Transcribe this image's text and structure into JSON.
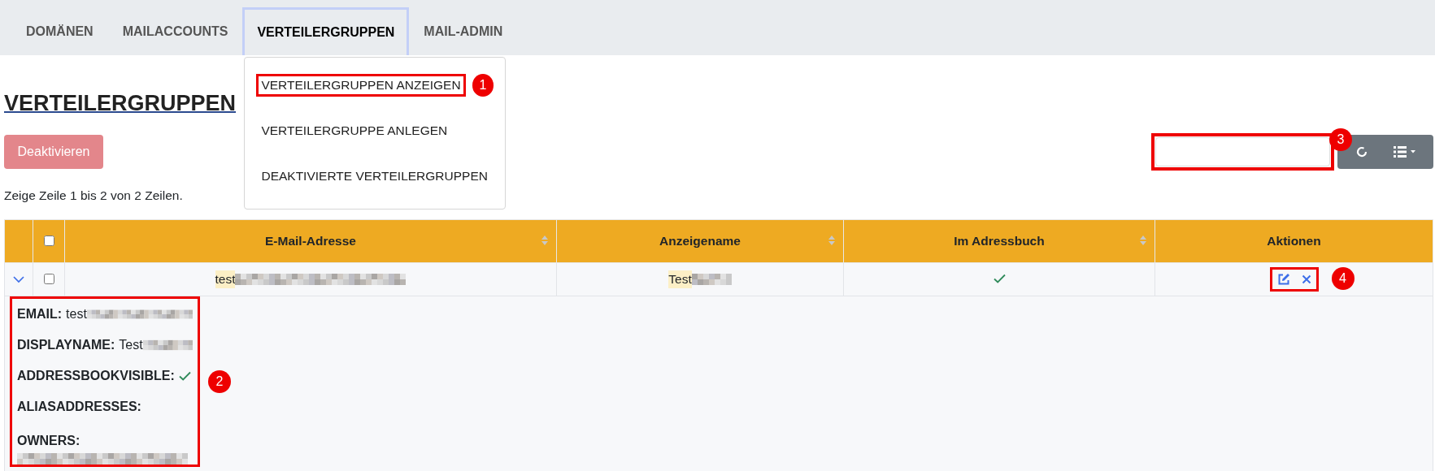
{
  "nav": {
    "tabs": [
      {
        "label": "DOMÄNEN",
        "selected": false
      },
      {
        "label": "MAILACCOUNTS",
        "selected": false
      },
      {
        "label": "VERTEILERGRUPPEN",
        "selected": true
      },
      {
        "label": "MAIL-ADMIN",
        "selected": false
      }
    ]
  },
  "dropdown": {
    "items": [
      {
        "label": "VERTEILERGRUPPEN ANZEIGEN",
        "annotation": "1"
      },
      {
        "label": "VERTEILERGRUPPE ANLEGEN"
      },
      {
        "label": "DEAKTIVIERTE VERTEILERGRUPPEN"
      }
    ]
  },
  "page_title": "VERTEILERGRUPPEN",
  "deactivate_button": {
    "label": "Deaktivieren",
    "disabled": true
  },
  "row_info": "Zeige Zeile 1 bis 2 von 2 Zeilen.",
  "search": {
    "annotation": "3"
  },
  "table": {
    "select_all_checked": false,
    "columns": [
      {
        "label": "E-Mail-Adresse",
        "sortable": true
      },
      {
        "label": "Anzeigename",
        "sortable": true
      },
      {
        "label": "Im Adressbuch",
        "sortable": true
      },
      {
        "label": "Aktionen",
        "sortable": false
      }
    ],
    "rows": [
      {
        "expanded": true,
        "checked": false,
        "email": "test",
        "email_redacted": true,
        "name": "Test",
        "name_redacted": true,
        "in_addressbook": true,
        "actions_annotation": "4",
        "details": {
          "annotation": "2",
          "fields": [
            {
              "kind": "text",
              "label": "EMAIL:",
              "value": "test",
              "redacted": true
            },
            {
              "kind": "text",
              "label": "DISPLAYNAME:",
              "value": "Test",
              "redacted": true
            },
            {
              "kind": "check",
              "label": "ADDRESSBOOKVISIBLE:",
              "checked": true
            },
            {
              "kind": "empty",
              "label": "ALIASADDRESSES:"
            },
            {
              "kind": "list",
              "label": "OWNERS:",
              "redacted": true
            }
          ]
        }
      }
    ]
  }
}
